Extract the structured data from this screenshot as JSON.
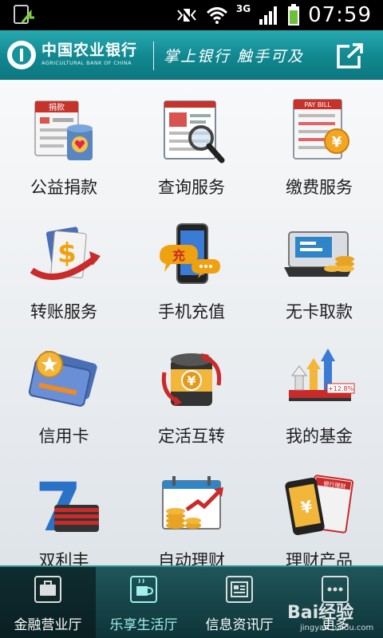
{
  "status_bar": {
    "time": "07:59",
    "network": "3G"
  },
  "header": {
    "bank_name_cn": "中国农业银行",
    "bank_name_en": "AGRICULTURAL BANK OF CHINA",
    "slogan": "掌上银行 触手可及"
  },
  "grid": {
    "items": [
      {
        "label": "公益捐款",
        "icon": "donation-icon"
      },
      {
        "label": "查询服务",
        "icon": "query-icon"
      },
      {
        "label": "缴费服务",
        "icon": "bill-payment-icon"
      },
      {
        "label": "转账服务",
        "icon": "transfer-icon"
      },
      {
        "label": "手机充值",
        "icon": "mobile-recharge-icon"
      },
      {
        "label": "无卡取款",
        "icon": "cardless-withdrawal-icon"
      },
      {
        "label": "信用卡",
        "icon": "credit-card-icon"
      },
      {
        "label": "定活互转",
        "icon": "deposit-convert-icon"
      },
      {
        "label": "我的基金",
        "icon": "fund-icon"
      },
      {
        "label": "双利丰",
        "icon": "shuanglifeng-icon"
      },
      {
        "label": "自动理财",
        "icon": "auto-investment-icon"
      },
      {
        "label": "理财产品",
        "icon": "investment-product-icon"
      }
    ],
    "icon_text": {
      "donate_tag": "捐款",
      "pay_bill": "PAY BILL",
      "yuan": "¥",
      "dollar": "$",
      "recharge": "充",
      "fund_pct": "+12.8%",
      "seven": "7",
      "product_tag": "银行理财"
    }
  },
  "tab_bar": {
    "tabs": [
      {
        "label": "金融营业厅",
        "icon": "briefcase-icon",
        "active": true
      },
      {
        "label": "乐享生活厅",
        "icon": "coffee-cup-icon",
        "active": false
      },
      {
        "label": "信息资讯厅",
        "icon": "newspaper-icon",
        "active": false
      },
      {
        "label": "更多",
        "icon": "more-icon",
        "active": false
      }
    ]
  },
  "watermark": {
    "text": "Bai经验",
    "url": "jingyan.baidu.com"
  },
  "colors": {
    "header": "#15939a",
    "tabbar": "#0e3438",
    "accent": "#9ff0ee"
  }
}
